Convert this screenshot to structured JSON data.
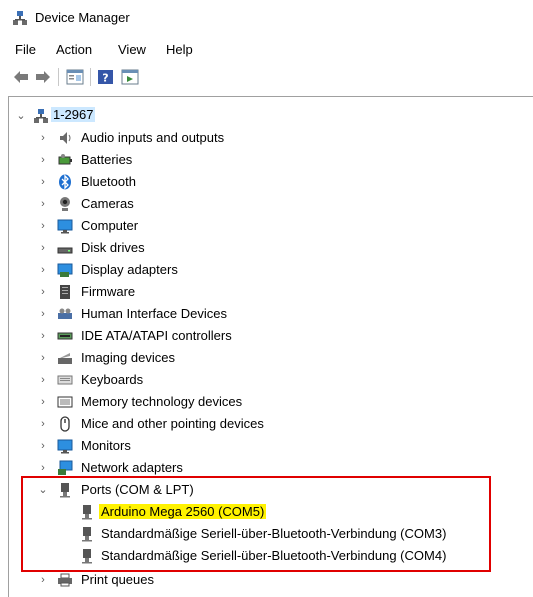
{
  "window": {
    "title": "Device Manager"
  },
  "menu": [
    "File",
    "Action",
    "View",
    "Help"
  ],
  "toolbar": {
    "buttons": [
      "back-arrow-icon",
      "forward-arrow-icon",
      "properties-icon",
      "help-icon",
      "show-hidden-icon"
    ]
  },
  "tree": {
    "root": "1-2967",
    "categories": [
      {
        "label": "Audio inputs and outputs",
        "icon": "speaker-icon"
      },
      {
        "label": "Batteries",
        "icon": "battery-icon"
      },
      {
        "label": "Bluetooth",
        "icon": "bluetooth-icon"
      },
      {
        "label": "Cameras",
        "icon": "camera-icon"
      },
      {
        "label": "Computer",
        "icon": "monitor-icon"
      },
      {
        "label": "Disk drives",
        "icon": "disk-icon"
      },
      {
        "label": "Display adapters",
        "icon": "display-adapter-icon"
      },
      {
        "label": "Firmware",
        "icon": "firmware-icon"
      },
      {
        "label": "Human Interface Devices",
        "icon": "hid-icon"
      },
      {
        "label": "IDE ATA/ATAPI controllers",
        "icon": "ide-icon"
      },
      {
        "label": "Imaging devices",
        "icon": "imaging-icon"
      },
      {
        "label": "Keyboards",
        "icon": "keyboard-icon"
      },
      {
        "label": "Memory technology devices",
        "icon": "memory-icon"
      },
      {
        "label": "Mice and other pointing devices",
        "icon": "mouse-icon"
      },
      {
        "label": "Monitors",
        "icon": "monitor-icon"
      },
      {
        "label": "Network adapters",
        "icon": "network-icon"
      }
    ],
    "ports": {
      "label": "Ports (COM & LPT)",
      "children": [
        "Arduino Mega 2560 (COM5)",
        "Standardmäßige Seriell-über-Bluetooth-Verbindung (COM3)",
        "Standardmäßige Seriell-über-Bluetooth-Verbindung (COM4)"
      ]
    },
    "after": [
      {
        "label": "Print queues",
        "icon": "printer-icon"
      }
    ]
  },
  "colors": {
    "selection": "#cce8ff",
    "highlight": "#fff200",
    "annotation": "#e00000"
  }
}
